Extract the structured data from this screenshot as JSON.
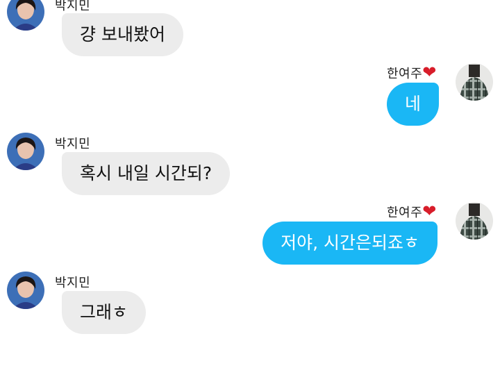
{
  "chat": {
    "other_user": {
      "name": "박지민"
    },
    "me": {
      "name": "한여주",
      "heart": "❤"
    },
    "messages": [
      {
        "sender": "박지민",
        "side": "left",
        "text": "걍 보내봤어"
      },
      {
        "sender": "한여주",
        "side": "right",
        "text": "네"
      },
      {
        "sender": "박지민",
        "side": "left",
        "text": "혹시 내일 시간되?"
      },
      {
        "sender": "한여주",
        "side": "right",
        "text": "저야, 시간은되죠ㅎ"
      },
      {
        "sender": "박지민",
        "side": "left",
        "text": "그래ㅎ"
      }
    ]
  },
  "colors": {
    "left_bubble": "#ececec",
    "right_bubble": "#1ab7f5",
    "heart": "#d81d2a"
  }
}
